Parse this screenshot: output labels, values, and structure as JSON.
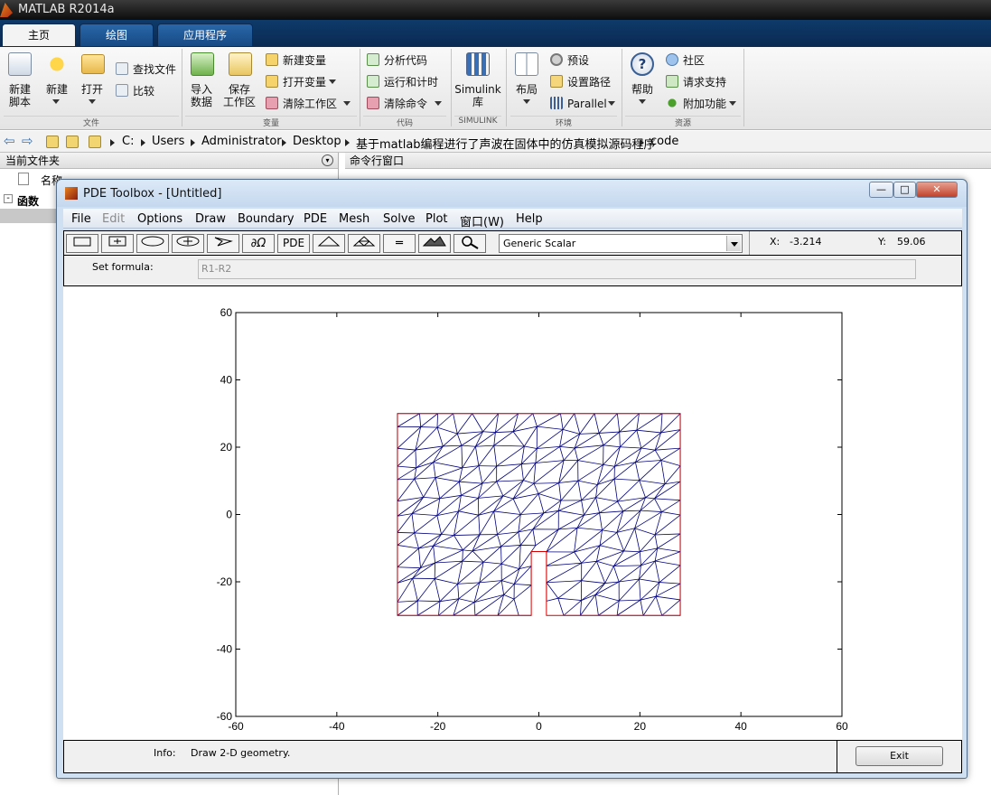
{
  "app": {
    "title": "MATLAB R2014a"
  },
  "tabs": [
    {
      "label": "主页"
    },
    {
      "label": "绘图"
    },
    {
      "label": "应用程序"
    }
  ],
  "ribbon": {
    "new_script": [
      "新建",
      "脚本"
    ],
    "new": "新建",
    "open": "打开",
    "find_files": "查找文件",
    "compare": "比较",
    "import": [
      "导入",
      "数据"
    ],
    "save": [
      "保存",
      "工作区"
    ],
    "new_var": "新建变量",
    "open_var": "打开变量",
    "clear_ws": "清除工作区",
    "analyze": "分析代码",
    "run_time": "运行和计时",
    "clear_cmd": "清除命令",
    "simulink": [
      "Simulink",
      "库"
    ],
    "layout": "布局",
    "prefs": "预设",
    "set_path": "设置路径",
    "parallel": "Parallel",
    "help": "帮助",
    "community": "社区",
    "support": "请求支持",
    "addons": "附加功能",
    "groups": {
      "file": "文件",
      "var": "变量",
      "code": "代码",
      "sim": "SIMULINK",
      "env": "环境",
      "res": "资源"
    }
  },
  "address": {
    "parts": [
      "C:",
      "Users",
      "Administrator",
      "Desktop",
      "基于matlab编程进行了声波在固体中的仿真模拟源码程序",
      "code"
    ]
  },
  "left_panel": {
    "title": "当前文件夹",
    "col_name": "名称",
    "section": "函数"
  },
  "cmd_panel": {
    "title": "命令行窗口"
  },
  "pde": {
    "title": "PDE Toolbox - [Untitled]",
    "menus": [
      "File",
      "Edit",
      "Options",
      "Draw",
      "Boundary",
      "PDE",
      "Mesh",
      "Solve",
      "Plot",
      "窗口(W)",
      "Help"
    ],
    "tool_pde": "PDE",
    "mode": "Generic Scalar",
    "x_label": "X:",
    "x_value": "-3.214",
    "y_label": "Y:",
    "y_value": "59.06",
    "formula_label": "Set formula:",
    "formula_value": "R1-R2",
    "info_label": "Info:",
    "info_text": "Draw 2-D geometry.",
    "exit_label": "Exit",
    "window_buttons": {
      "min": "—",
      "max": "□",
      "close": "✕"
    }
  },
  "chart_data": {
    "type": "scatter",
    "description_note": "",
    "xlim": [
      -60,
      60
    ],
    "ylim": [
      -60,
      60
    ],
    "x_ticks": [
      -60,
      -40,
      -20,
      0,
      20,
      40,
      60
    ],
    "y_ticks": [
      -60,
      -40,
      -20,
      0,
      20,
      40,
      60
    ],
    "geometry_boundary": [
      [
        -28,
        30
      ],
      [
        28,
        30
      ],
      [
        28,
        -30
      ],
      [
        1.5,
        -30
      ],
      [
        1.5,
        -11
      ],
      [
        -1.5,
        -11
      ],
      [
        -1.5,
        -30
      ],
      [
        -28,
        -30
      ]
    ],
    "edge_color": "#d40000",
    "mesh_color": "#00007a",
    "mesh_nx": 14,
    "mesh_ny": 12
  }
}
